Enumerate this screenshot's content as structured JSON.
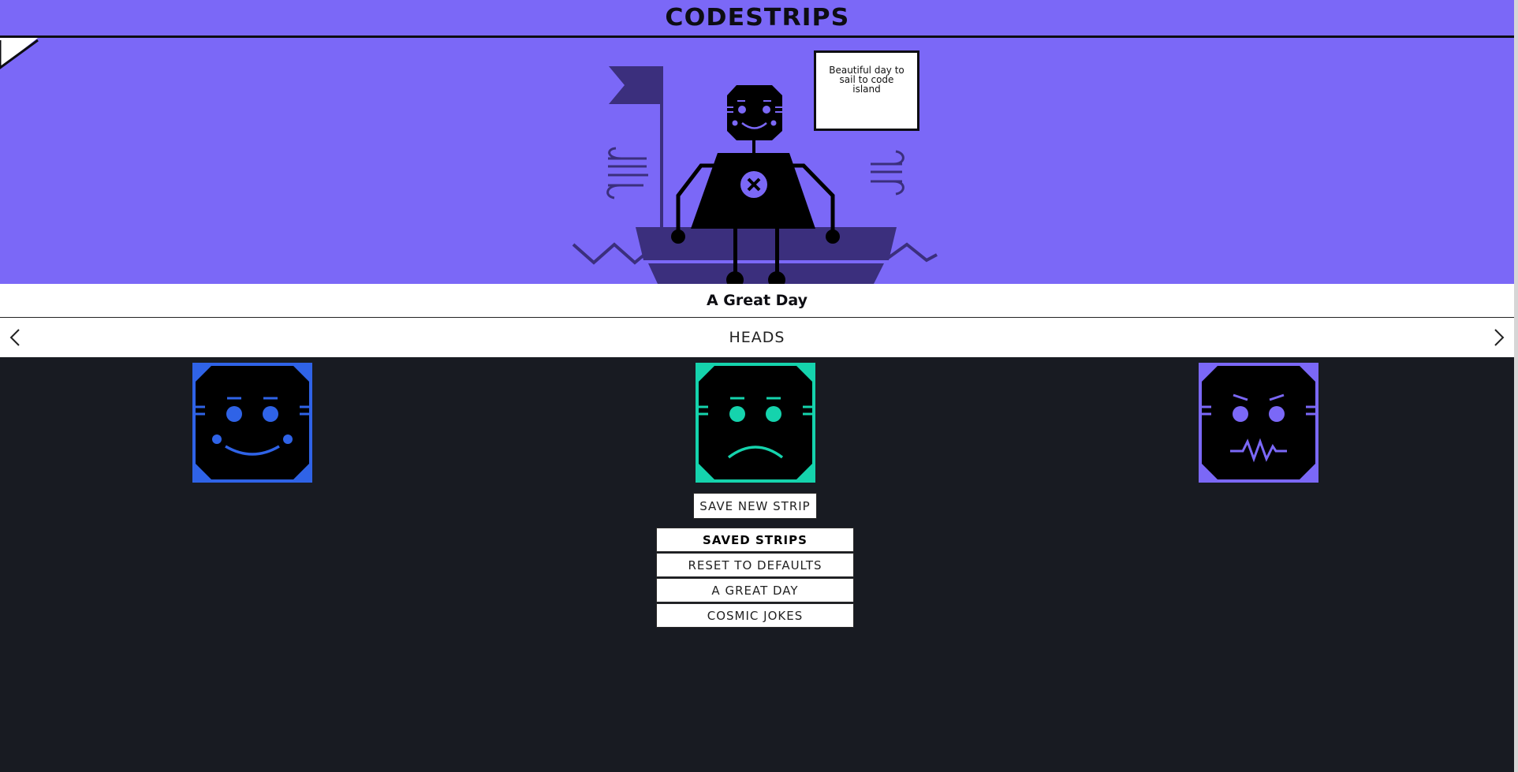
{
  "app": {
    "title": "CODESTRIPS"
  },
  "scene": {
    "speech": "Beautiful day to sail to code island"
  },
  "caption": "A Great Day",
  "selector": {
    "label": "HEADS",
    "prev_icon": "chevron-left-icon",
    "next_icon": "chevron-right-icon"
  },
  "heads": [
    {
      "name": "happy-head",
      "color": "#2f63e7"
    },
    {
      "name": "sad-head",
      "color": "#15d3ad"
    },
    {
      "name": "angry-head",
      "color": "#7b68f7"
    }
  ],
  "actions": {
    "save": "SAVE NEW STRIP"
  },
  "saved_strips": {
    "heading": "SAVED STRIPS",
    "items": [
      "RESET TO DEFAULTS",
      "A GREAT DAY",
      "COSMIC JOKES"
    ]
  },
  "colors": {
    "accent": "#7b68f7",
    "background": "#181b22",
    "ink": "#0d0d12",
    "boat": "#3b2f7d"
  }
}
